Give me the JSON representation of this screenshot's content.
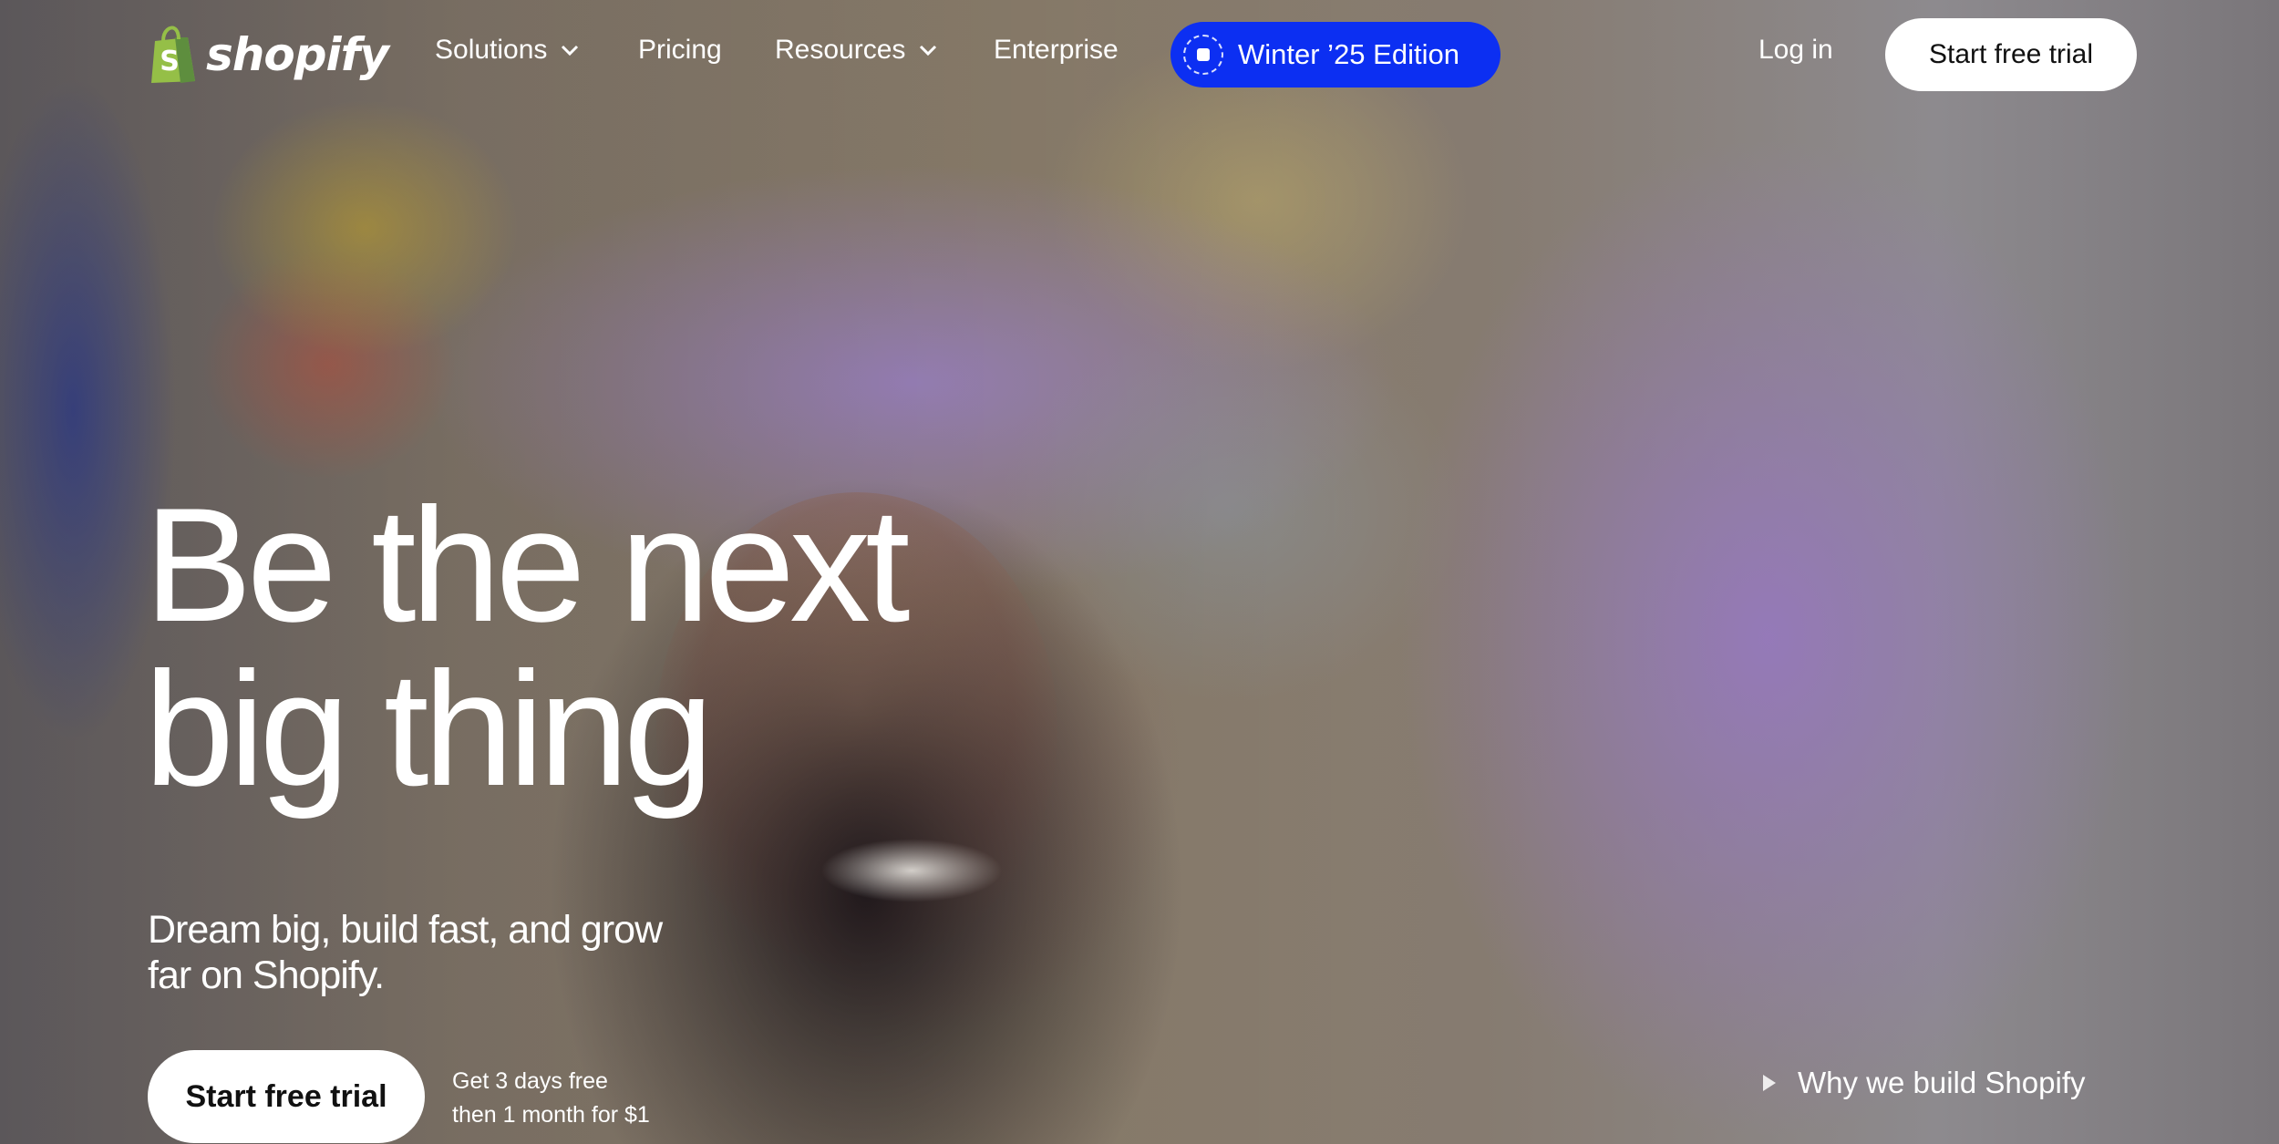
{
  "brand": {
    "name": "shopify",
    "accent_color": "#0c2ff2",
    "logo_green": "#95bf47"
  },
  "nav": {
    "items": [
      {
        "label": "Solutions",
        "has_dropdown": true
      },
      {
        "label": "Pricing",
        "has_dropdown": false
      },
      {
        "label": "Resources",
        "has_dropdown": true
      },
      {
        "label": "Enterprise",
        "has_dropdown": false
      }
    ],
    "edition_label": "Winter ’25 Edition",
    "login_label": "Log in",
    "cta_label": "Start free trial"
  },
  "hero": {
    "title_lines": [
      "Be the next",
      "big thing"
    ],
    "subtitle_lines": [
      "Dream big, build fast, and grow",
      "far on Shopify."
    ],
    "cta_label": "Start free trial",
    "offer_lines": [
      "Get 3 days free",
      "then 1 month for $1"
    ],
    "video_link_label": "Why we build Shopify"
  },
  "icons": {
    "logo": "shopify-bag-icon",
    "dropdown": "chevron-down-icon",
    "edition_badge": "edition-badge-icon",
    "video": "play-icon"
  }
}
